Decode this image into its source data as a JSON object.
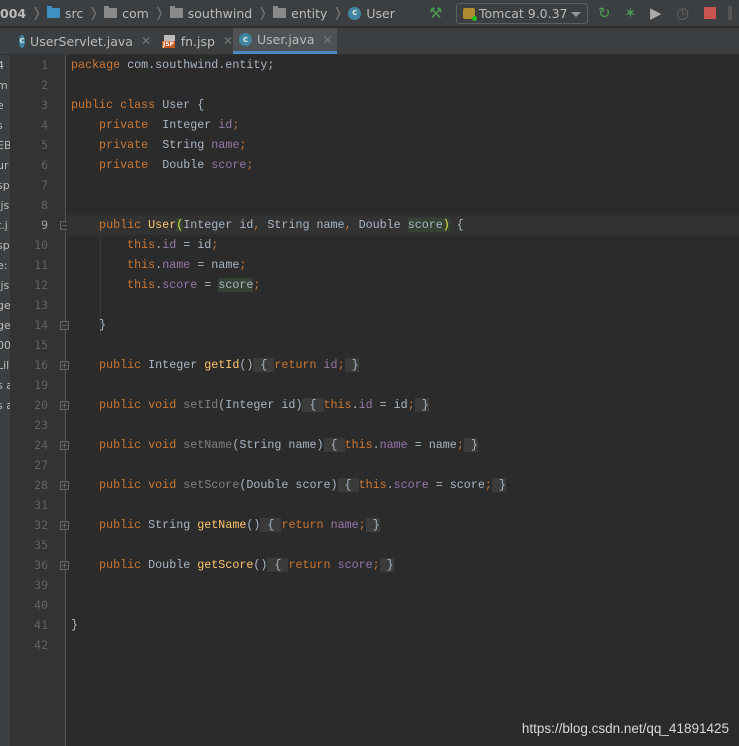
{
  "breadcrumb": [
    {
      "label": "004",
      "icon": "none"
    },
    {
      "label": "src",
      "icon": "source-folder-icon"
    },
    {
      "label": "com",
      "icon": "package-folder-icon"
    },
    {
      "label": "southwind",
      "icon": "package-folder-icon"
    },
    {
      "label": "entity",
      "icon": "package-folder-icon"
    },
    {
      "label": "User",
      "icon": "class-icon"
    }
  ],
  "toolbar": {
    "run_config": "Tomcat 9.0.37",
    "icons": [
      "build-hammer-icon",
      "tomcat-icon",
      "rerun-icon",
      "debug-icon",
      "coverage-icon",
      "profile-icon",
      "stop-icon"
    ]
  },
  "tabs": [
    {
      "label": "UserServlet.java",
      "icon": "class-icon",
      "active": false
    },
    {
      "label": "fn.jsp",
      "icon": "jsp-icon",
      "active": false
    },
    {
      "label": "User.java",
      "icon": "class-icon",
      "active": true
    }
  ],
  "left_panel_fragments": [
    "4",
    "m",
    "e",
    "s",
    "EB",
    "ur",
    "sp",
    ".js",
    "t.j",
    "sp",
    "e:",
    ".js",
    "ge",
    "ge",
    "00",
    "Lil",
    "s a",
    "s a"
  ],
  "editor": {
    "line_numbers": [
      "1",
      "2",
      "3",
      "4",
      "5",
      "6",
      "7",
      "8",
      "9",
      "10",
      "11",
      "12",
      "13",
      "14",
      "15",
      "16",
      "19",
      "20",
      "23",
      "24",
      "27",
      "28",
      "31",
      "32",
      "35",
      "36",
      "39",
      "40",
      "41",
      "42"
    ],
    "current_line": "9",
    "lines": [
      [
        [
          "k",
          "package "
        ],
        [
          "t",
          "com.southwind.entity;"
        ]
      ],
      [],
      [
        [
          "k",
          "public class "
        ],
        [
          "t",
          "User {"
        ]
      ],
      [
        [
          "k",
          "    private  "
        ],
        [
          "t",
          "Integer "
        ],
        [
          "f",
          "id"
        ],
        [
          "k",
          ";"
        ]
      ],
      [
        [
          "k",
          "    private  "
        ],
        [
          "t",
          "String "
        ],
        [
          "f",
          "name"
        ],
        [
          "k",
          ";"
        ]
      ],
      [
        [
          "k",
          "    private  "
        ],
        [
          "t",
          "Double "
        ],
        [
          "f",
          "score"
        ],
        [
          "k",
          ";"
        ]
      ],
      [],
      [],
      [
        [
          "k",
          "    public "
        ],
        [
          "m",
          "User"
        ],
        [
          "hy",
          "("
        ],
        [
          "t",
          "Integer id"
        ],
        [
          "k",
          ", "
        ],
        [
          "t",
          "String name"
        ],
        [
          "k",
          ", "
        ],
        [
          "t",
          "Double "
        ],
        [
          "h",
          "score"
        ],
        [
          "hy",
          ")"
        ],
        [
          "t",
          " {"
        ]
      ],
      [
        [
          "k",
          "        this"
        ],
        [
          "t",
          "."
        ],
        [
          "f",
          "id"
        ],
        [
          "t",
          " = id"
        ],
        [
          "k",
          ";"
        ]
      ],
      [
        [
          "k",
          "        this"
        ],
        [
          "t",
          "."
        ],
        [
          "f",
          "name"
        ],
        [
          "t",
          " = name"
        ],
        [
          "k",
          ";"
        ]
      ],
      [
        [
          "k",
          "        this"
        ],
        [
          "t",
          "."
        ],
        [
          "f",
          "score"
        ],
        [
          "t",
          " = "
        ],
        [
          "h",
          "score"
        ],
        [
          "k",
          ";"
        ]
      ],
      [],
      [
        [
          "t",
          "    }"
        ]
      ],
      [],
      [
        [
          "k",
          "    public "
        ],
        [
          "t",
          "Integer "
        ],
        [
          "m",
          "getId"
        ],
        [
          "t",
          "()"
        ],
        [
          "fb",
          " { "
        ],
        [
          "k",
          "return "
        ],
        [
          "f",
          "id"
        ],
        [
          "k",
          ";"
        ],
        [
          "fb",
          " }"
        ]
      ],
      [],
      [
        [
          "k",
          "    public void "
        ],
        [
          "u",
          "setId"
        ],
        [
          "t",
          "(Integer id)"
        ],
        [
          "fb",
          " { "
        ],
        [
          "k",
          "this"
        ],
        [
          "t",
          "."
        ],
        [
          "f",
          "id"
        ],
        [
          "t",
          " = id"
        ],
        [
          "k",
          ";"
        ],
        [
          "fb",
          " }"
        ]
      ],
      [],
      [
        [
          "k",
          "    public void "
        ],
        [
          "u",
          "setName"
        ],
        [
          "t",
          "(String name)"
        ],
        [
          "fb",
          " { "
        ],
        [
          "k",
          "this"
        ],
        [
          "t",
          "."
        ],
        [
          "f",
          "name"
        ],
        [
          "t",
          " = name"
        ],
        [
          "k",
          ";"
        ],
        [
          "fb",
          " }"
        ]
      ],
      [],
      [
        [
          "k",
          "    public void "
        ],
        [
          "u",
          "setScore"
        ],
        [
          "t",
          "(Double score)"
        ],
        [
          "fb",
          " { "
        ],
        [
          "k",
          "this"
        ],
        [
          "t",
          "."
        ],
        [
          "f",
          "score"
        ],
        [
          "t",
          " = score"
        ],
        [
          "k",
          ";"
        ],
        [
          "fb",
          " }"
        ]
      ],
      [],
      [
        [
          "k",
          "    public "
        ],
        [
          "t",
          "String "
        ],
        [
          "m",
          "getName"
        ],
        [
          "t",
          "()"
        ],
        [
          "fb",
          " { "
        ],
        [
          "k",
          "return "
        ],
        [
          "f",
          "name"
        ],
        [
          "k",
          ";"
        ],
        [
          "fb",
          " }"
        ]
      ],
      [],
      [
        [
          "k",
          "    public "
        ],
        [
          "t",
          "Double "
        ],
        [
          "m",
          "getScore"
        ],
        [
          "t",
          "()"
        ],
        [
          "fb",
          " { "
        ],
        [
          "k",
          "return "
        ],
        [
          "f",
          "score"
        ],
        [
          "k",
          ";"
        ],
        [
          "fb",
          " }"
        ]
      ],
      [],
      [],
      [
        [
          "t",
          "}"
        ]
      ],
      []
    ]
  },
  "colors": {
    "keyword": "#cc7832",
    "field": "#9876aa",
    "method": "#ffc66d",
    "text": "#a9b7c6",
    "unused": "#808080",
    "background": "#2b2b2b"
  },
  "watermark": "https://blog.csdn.net/qq_41891425"
}
